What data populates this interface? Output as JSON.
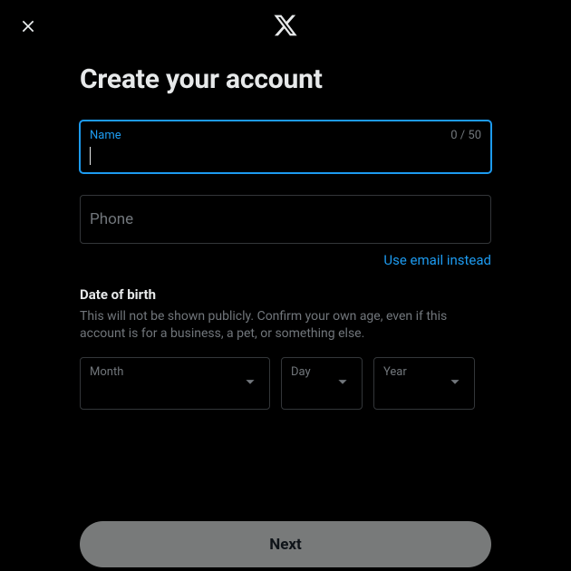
{
  "header": {
    "title": "Create your account"
  },
  "name_field": {
    "label": "Name",
    "counter": "0 / 50",
    "value": ""
  },
  "phone_field": {
    "placeholder": "Phone"
  },
  "alt_link": {
    "label": "Use email instead"
  },
  "dob": {
    "title": "Date of birth",
    "description": "This will not be shown publicly. Confirm your own age, even if this account is for a business, a pet, or something else.",
    "month_label": "Month",
    "day_label": "Day",
    "year_label": "Year"
  },
  "next_button": {
    "label": "Next"
  }
}
